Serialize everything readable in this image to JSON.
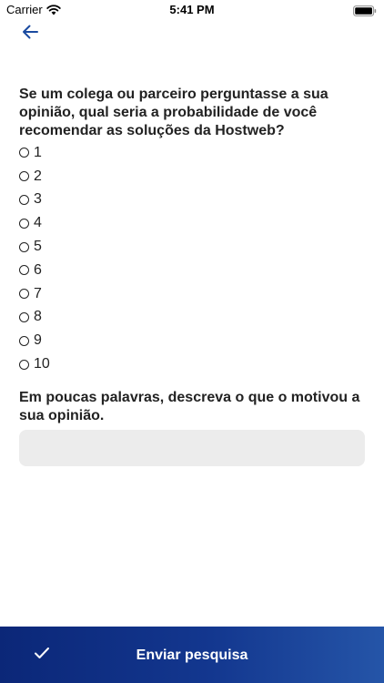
{
  "status_bar": {
    "carrier": "Carrier",
    "time": "5:41 PM",
    "wifi_icon": "wifi-icon",
    "battery_icon": "battery-icon"
  },
  "nav": {
    "back_icon": "arrow-left-icon",
    "accent_color": "#1a4aa0"
  },
  "survey": {
    "question_1": "Se um colega ou parceiro perguntasse a sua opinião, qual seria a probabilidade de você recomendar as soluções da Hostweb?",
    "options": [
      "1",
      "2",
      "3",
      "4",
      "5",
      "6",
      "7",
      "8",
      "9",
      "10"
    ],
    "question_2": "Em poucas palavras, descreva o que o motivou a sua opinião.",
    "comment_value": "",
    "comment_placeholder": ""
  },
  "footer": {
    "submit_label": "Enviar pesquisa",
    "submit_icon": "checkmark-icon",
    "gradient_start": "#0b2778",
    "gradient_end": "#2555a8"
  }
}
